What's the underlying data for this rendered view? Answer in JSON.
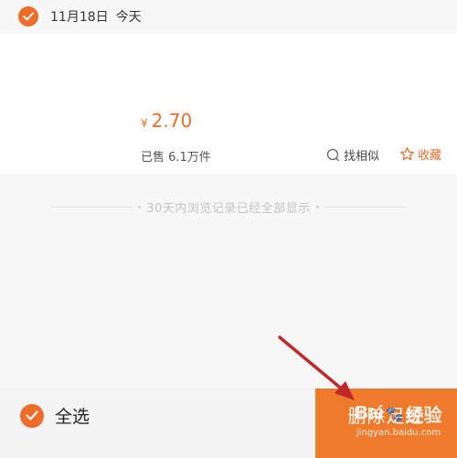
{
  "header": {
    "date": "11月18日",
    "today": "今天"
  },
  "product": {
    "currency": "¥",
    "price": "2.70",
    "sold": "已售 6.1万件",
    "find_similar": "找相似",
    "favorite": "收藏"
  },
  "list_end_note": "30天内浏览记录已经全部显示",
  "footer": {
    "select_all": "全选",
    "delete_label": "删除足迹"
  },
  "watermark": {
    "brand": "Bai",
    "brand_suffix": "经验",
    "url": "jingyan.baidu.com"
  },
  "colors": {
    "accent": "#ef6c28",
    "delete_button": "#ef7a2b",
    "annotation_arrow": "#c0282a"
  }
}
